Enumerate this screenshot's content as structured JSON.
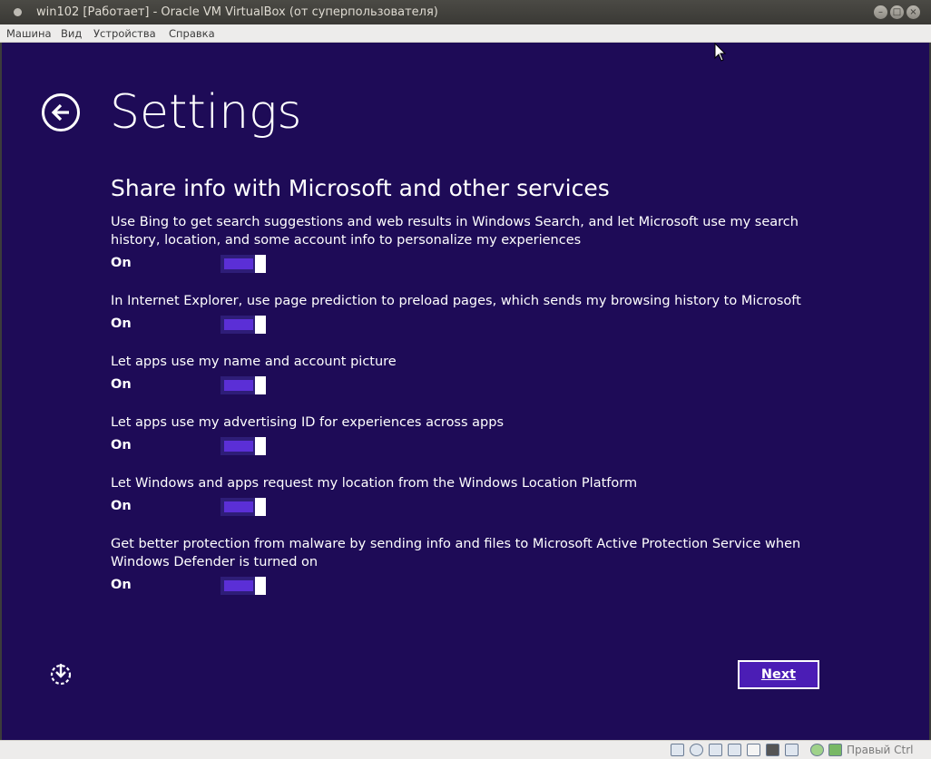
{
  "window": {
    "title": "win102 [Работает] - Oracle VM VirtualBox (от суперпользователя)",
    "buttons": {
      "minimize": "–",
      "maximize": "□",
      "close": "×"
    }
  },
  "menu": {
    "items": [
      "Машина",
      "Вид",
      "Устройства",
      "Справка"
    ]
  },
  "guest": {
    "page_title": "Settings",
    "section_title": "Share info with Microsoft and other services",
    "settings": [
      {
        "text": "Use Bing to get search suggestions and web results in Windows Search, and let Microsoft use my search history, location, and some account info to personalize my experiences",
        "state": "On"
      },
      {
        "text": "In Internet Explorer, use page prediction to preload pages, which sends my browsing history to Microsoft",
        "state": "On"
      },
      {
        "text": "Let apps use my name and account picture",
        "state": "On"
      },
      {
        "text": "Let apps use my advertising ID for experiences across apps",
        "state": "On"
      },
      {
        "text": "Let Windows and apps request my location from the Windows Location Platform",
        "state": "On"
      },
      {
        "text": "Get better protection from malware by sending info and files to Microsoft Active Protection Service when Windows Defender is turned on",
        "state": "On"
      }
    ],
    "next_button": "Next",
    "colors": {
      "background": "#1e0b57",
      "accent": "#5b2fd6",
      "button": "#4b1db5"
    },
    "icons": {
      "back": "back-arrow-icon",
      "ease_of_access": "ease-of-access-icon"
    }
  },
  "statusbar": {
    "host_key": "Правый Ctrl",
    "icons": [
      "hdd-icon",
      "optical-disc-icon",
      "usb-icon",
      "shared-folders-icon",
      "display-icon",
      "video-capture-icon",
      "vrde-icon",
      "network-icon",
      "mouse-integration-icon"
    ]
  }
}
